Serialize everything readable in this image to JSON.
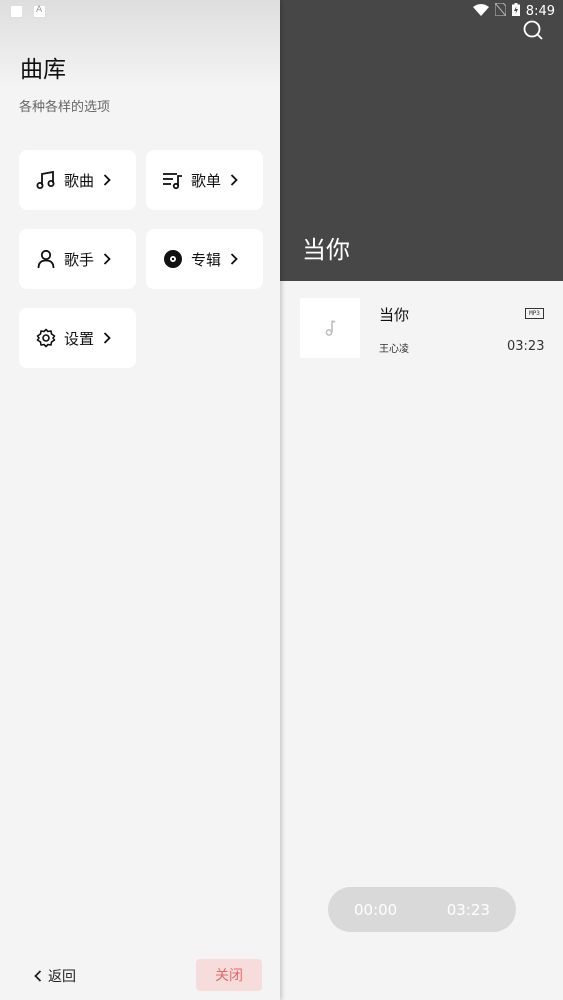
{
  "status_bar": {
    "time": "8:49"
  },
  "drawer": {
    "title": "曲库",
    "subtitle": "各种各样的选项",
    "items": [
      {
        "label": "歌曲",
        "icon": "music-note-icon"
      },
      {
        "label": "歌单",
        "icon": "playlist-icon"
      },
      {
        "label": "歌手",
        "icon": "person-icon"
      },
      {
        "label": "专辑",
        "icon": "album-icon"
      },
      {
        "label": "设置",
        "icon": "gear-icon"
      }
    ],
    "back_label": "返回",
    "close_label": "关闭"
  },
  "main": {
    "title": "当你",
    "song": {
      "title": "当你",
      "artist": "王心凌",
      "format": "MP3",
      "duration": "03:23"
    }
  },
  "player": {
    "current_time": "00:00",
    "total_time": "03:23"
  },
  "colors": {
    "header_bg": "#474747",
    "close_bg": "#f7dcdc",
    "close_text": "#e46a6a"
  }
}
